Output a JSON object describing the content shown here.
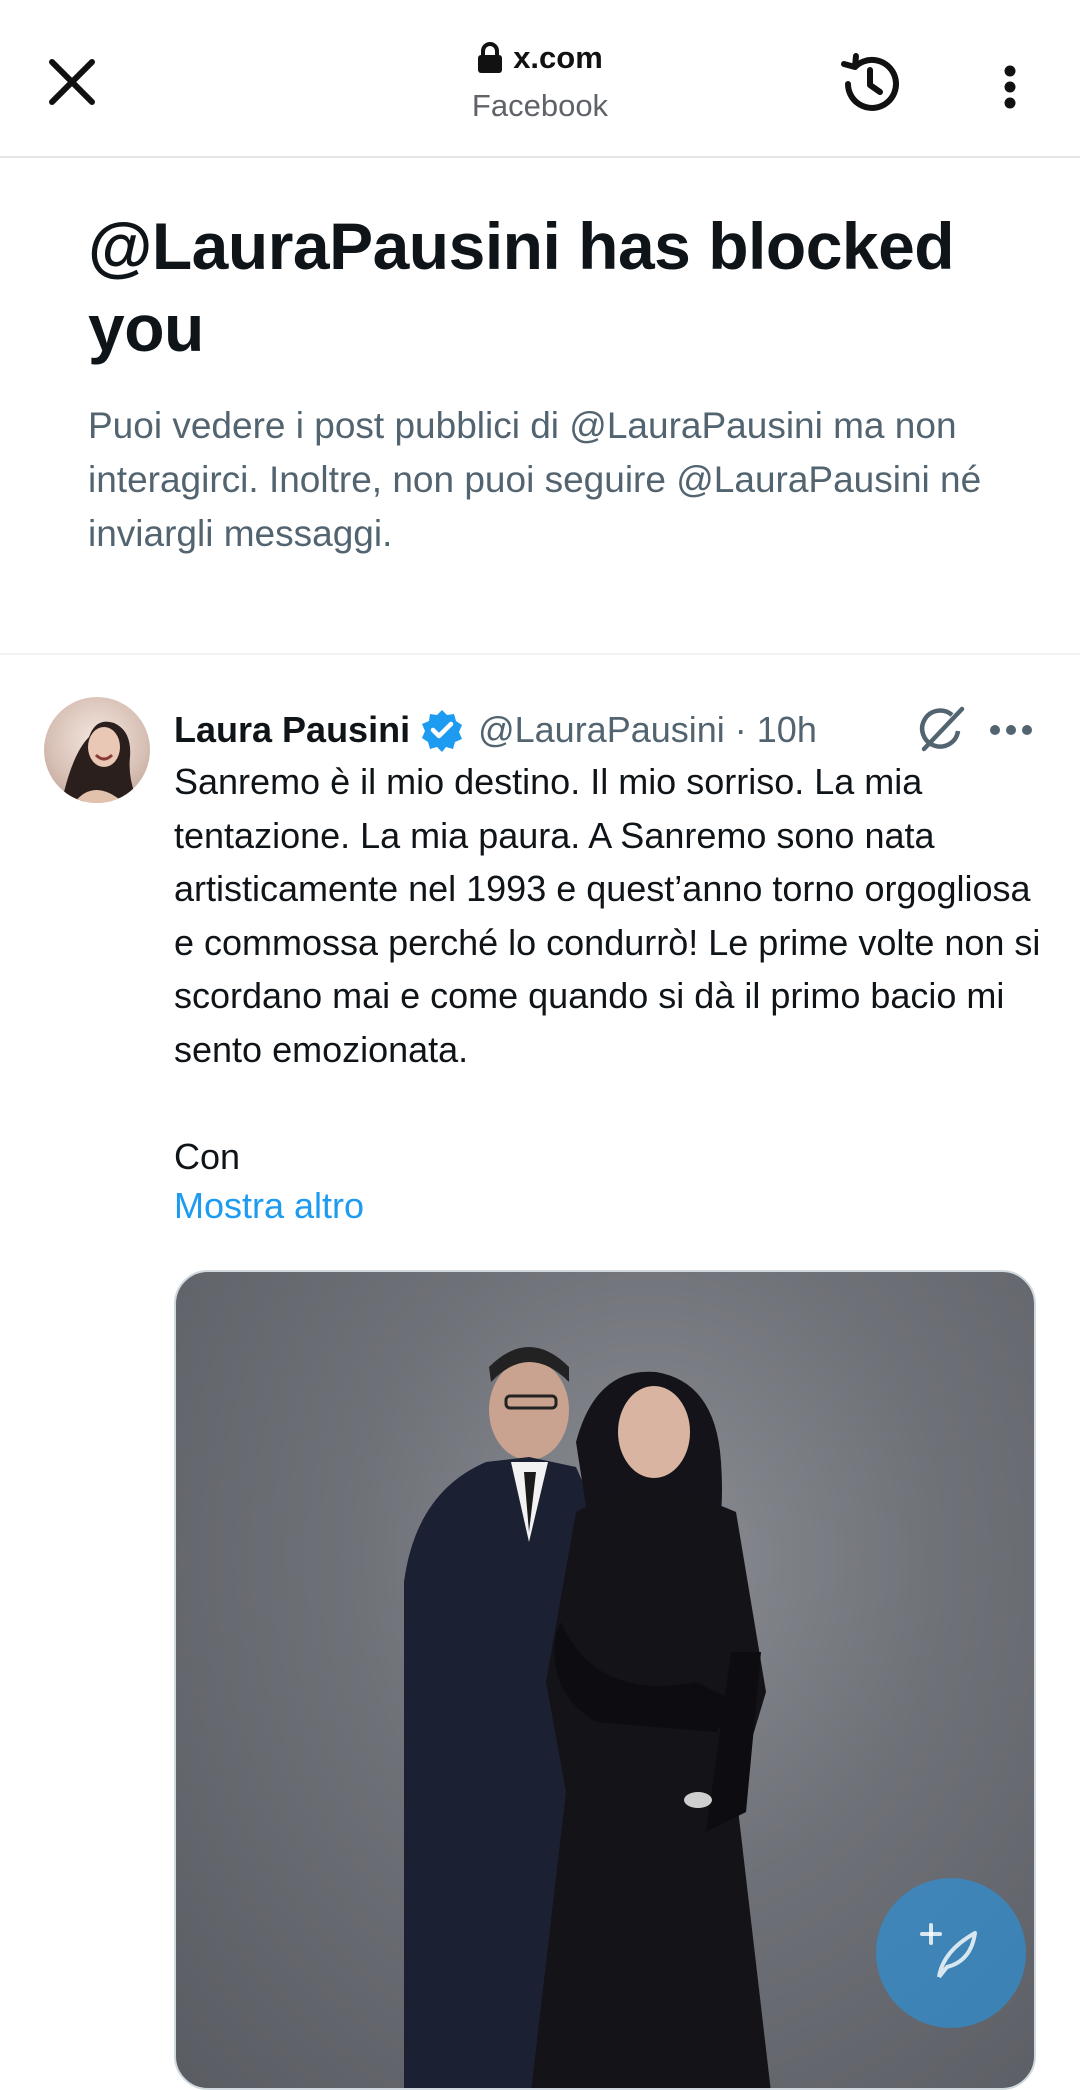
{
  "browser": {
    "url": "x.com",
    "site_name": "Facebook"
  },
  "blocked_notice": {
    "title": "@LauraPausini has blocked you",
    "description": "Puoi vedere i post pubblici di @LauraPausini ma non interagirci. Inoltre, non puoi seguire @LauraPausini né inviargli messaggi."
  },
  "tweet": {
    "author_name": "Laura Pausini",
    "handle": "@LauraPausini",
    "separator": "·",
    "time": "10h",
    "text": "Sanremo è il mio destino. Il mio sorriso. La mia tentazione. La mia paura. A Sanremo sono nata artisticamente nel 1993 e quest’anno torno orgogliosa e commossa perché lo condurrò! Le prime volte non si scordano mai e come quando si dà il primo bacio mi sento emozionata.\n\nCon",
    "show_more_label": "Mostra altro"
  },
  "colors": {
    "accent": "#1d9bf0",
    "secondary_text": "#536471",
    "primary_text": "#0f1419"
  },
  "icons": {
    "close": "close-icon",
    "lock": "lock-icon",
    "history": "history-icon",
    "menu": "more-vertical-icon",
    "verified": "verified-badge-icon",
    "grok": "grok-icon",
    "more": "more-horizontal-icon",
    "compose": "compose-post-icon"
  }
}
